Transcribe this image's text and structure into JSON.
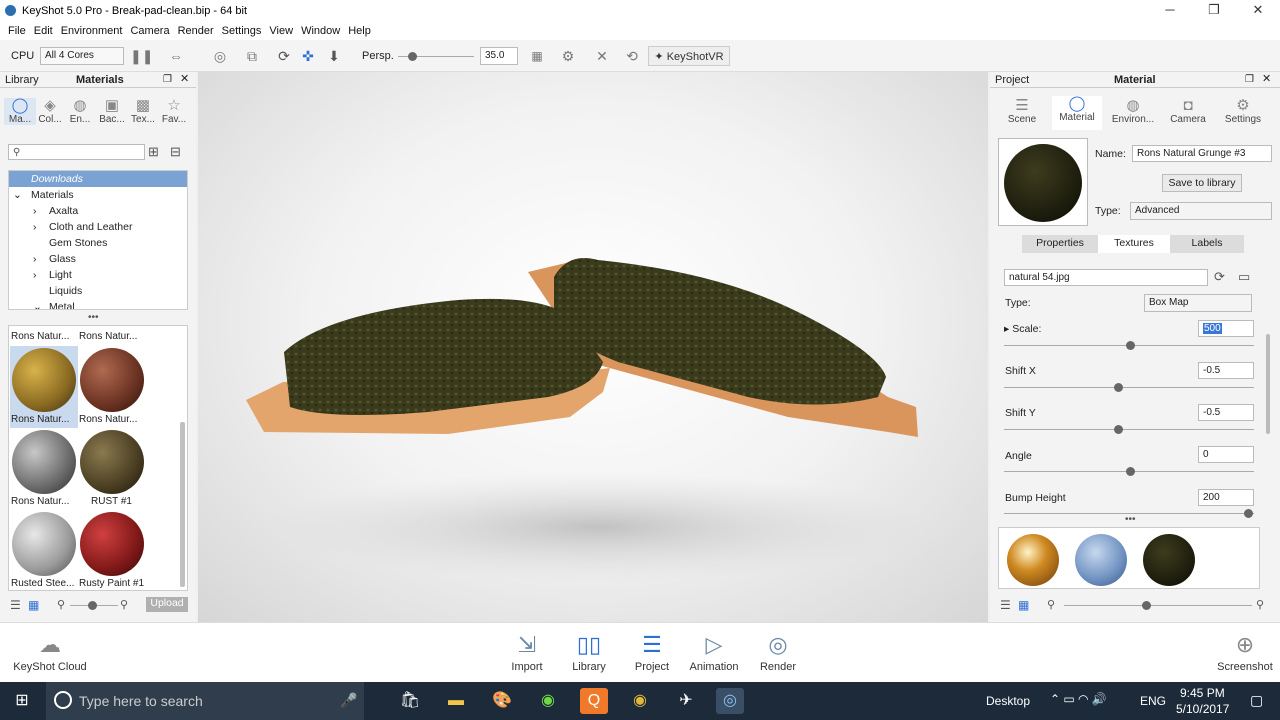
{
  "window": {
    "title": "KeyShot 5.0 Pro  -  Break-pad-clean.bip  -  64 bit",
    "minimize": "─",
    "maximize": "❐",
    "close": "✕"
  },
  "menu": [
    "File",
    "Edit",
    "Environment",
    "Camera",
    "Render",
    "Settings",
    "View",
    "Window",
    "Help"
  ],
  "toolbar": {
    "cpu_label": "CPU",
    "cores": "All 4 Cores",
    "persp_label": "Persp.",
    "fov": "35.0",
    "vr_label": "KeyShotVR"
  },
  "library": {
    "title_left": "Library",
    "title": "Materials",
    "tabs": [
      "Ma...",
      "Col...",
      "En...",
      "Bac...",
      "Tex...",
      "Fav..."
    ],
    "search_placeholder": "",
    "tree": [
      {
        "label": "Downloads",
        "arrow": ""
      },
      {
        "label": "Materials",
        "arrow": "⌄"
      },
      {
        "label": "Axalta",
        "arrow": "›"
      },
      {
        "label": "Cloth and Leather",
        "arrow": "›"
      },
      {
        "label": "Gem Stones",
        "arrow": ""
      },
      {
        "label": "Glass",
        "arrow": "›"
      },
      {
        "label": "Light",
        "arrow": "›"
      },
      {
        "label": "Liquids",
        "arrow": ""
      },
      {
        "label": "Metal",
        "arrow": "⌄"
      }
    ],
    "top_labels": [
      "Rons Natur...",
      "Rons Natur..."
    ],
    "thumbs": [
      "Rons Natur...",
      "Rons Natur...",
      "Rons Natur...",
      "RUST #1",
      "Rusted Stee...",
      "Rusty Paint #1"
    ],
    "upload": "Upload"
  },
  "project": {
    "title_left": "Project",
    "title": "Material",
    "tabs": [
      "Scene",
      "Material",
      "Environ...",
      "Camera",
      "Settings"
    ],
    "name_label": "Name:",
    "name_value": "Rons Natural Grunge #3",
    "save_button": "Save to library",
    "type_label": "Type:",
    "type_value": "Advanced",
    "subtabs": [
      "Properties",
      "Textures",
      "Labels"
    ],
    "texture_file": "natural 54.jpg",
    "tex_type_label": "Type:",
    "tex_type_value": "Box Map",
    "params": [
      {
        "label": "Scale:",
        "value": "500"
      },
      {
        "label": "Shift X",
        "value": "-0.5"
      },
      {
        "label": "Shift Y",
        "value": "-0.5"
      },
      {
        "label": "Angle",
        "value": "0"
      },
      {
        "label": "Bump Height",
        "value": "200"
      }
    ]
  },
  "dock": {
    "cloud": "KeyShot Cloud",
    "items": [
      "Import",
      "Library",
      "Project",
      "Animation",
      "Render"
    ],
    "screenshot": "Screenshot"
  },
  "taskbar": {
    "search_placeholder": "Type here to search",
    "desktop": "Desktop",
    "lang": "ENG",
    "time": "9:45 PM",
    "date": "5/10/2017"
  }
}
